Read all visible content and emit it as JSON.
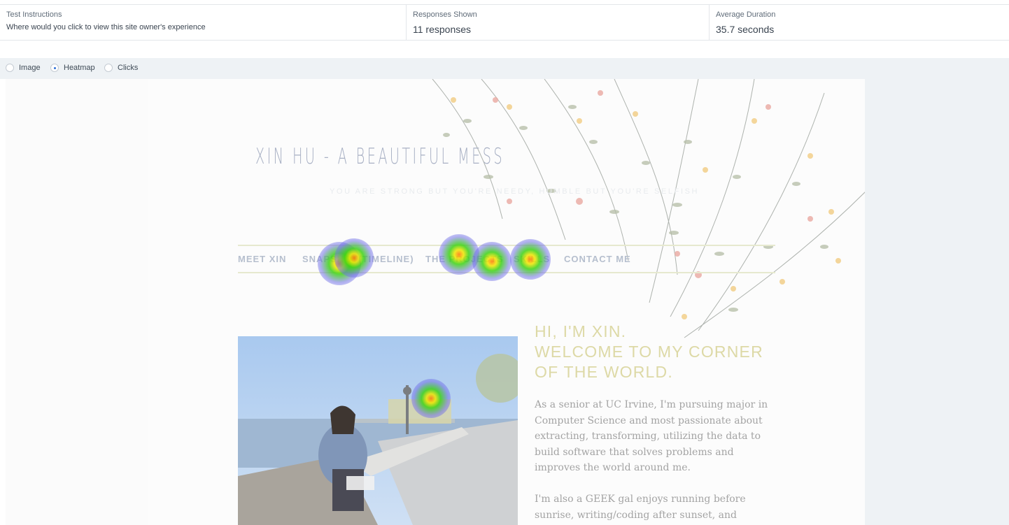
{
  "stats": {
    "instructions": {
      "label": "Test Instructions",
      "value": "Where would you click to view this site owner's experience"
    },
    "responses": {
      "label": "Responses Shown",
      "value": "11 responses"
    },
    "duration": {
      "label": "Average Duration",
      "value": "35.7 seconds"
    }
  },
  "view_options": {
    "image": "Image",
    "heatmap": "Heatmap",
    "clicks": "Clicks",
    "selected": "Heatmap"
  },
  "site": {
    "title": "XIN HU - A BEAUTIFUL MESS",
    "tagline": "YOU ARE STRONG BUT YOU'RE NEEDY, HUMBLE BUT YOU'RE SELFISH",
    "nav": [
      "MEET XIN",
      "SNAPSHOT(TIMELINE)",
      "THE PROJECTS",
      "SKILLS",
      "CONTACT ME"
    ],
    "greeting": [
      "HI, I'M XIN.",
      "WELCOME TO MY CORNER",
      "OF THE WORLD."
    ],
    "bio_1": [
      "As a senior at UC Irvine, I'm pursuing major in",
      "Computer Science and most passionate about",
      "extracting, transforming, utilizing the data to",
      "build software that solves problems and",
      "improves the world around me."
    ],
    "bio_2": [
      "I'm also a GEEK gal enjoys running before",
      "sunrise, writing/coding after sunset, and"
    ]
  },
  "colors": {
    "accent": "#2d6fd6",
    "nav_text": "#b6bfce",
    "greeting_text": "#ddd9a6",
    "switchbar_bg": "#eef2f5"
  }
}
